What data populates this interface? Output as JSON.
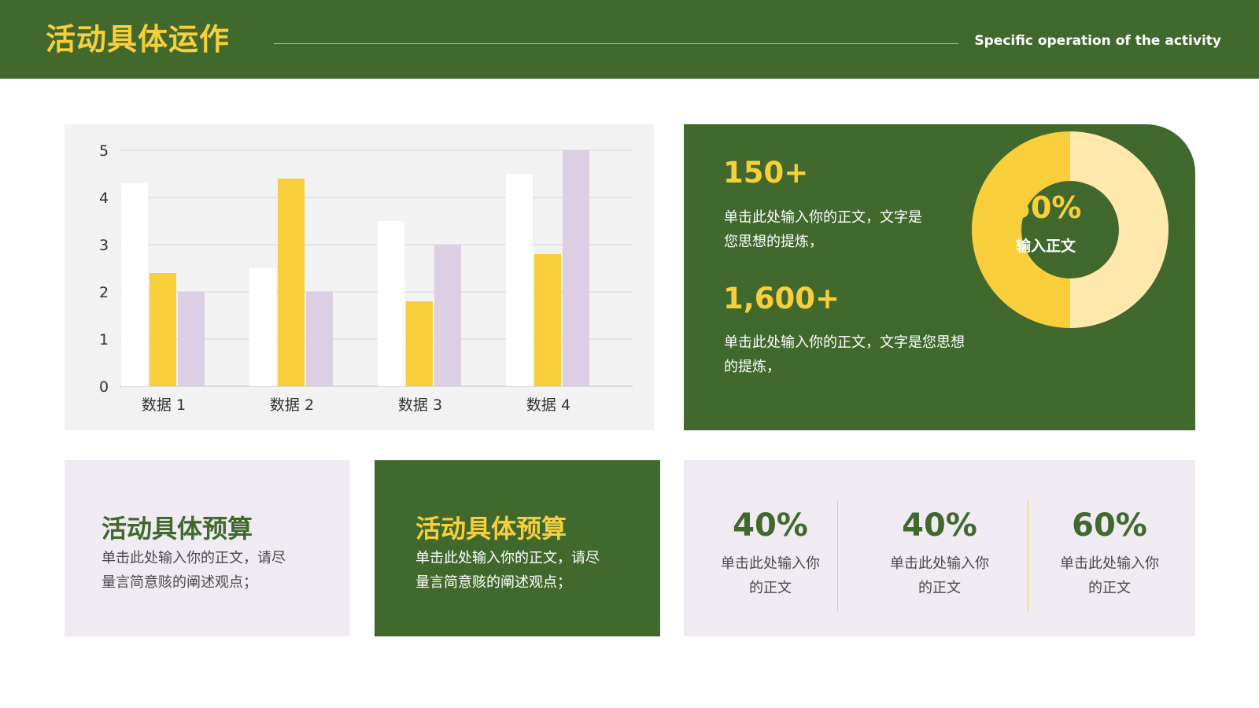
{
  "header": {
    "title": "活动具体运作",
    "subtitle": "Specific operation of the activity"
  },
  "chart_data": {
    "type": "bar",
    "categories": [
      "数据 1",
      "数据 2",
      "数据 3",
      "数据 4"
    ],
    "series": [
      {
        "values": [
          4.3,
          2.5,
          3.5,
          4.5
        ],
        "color": "#ffffff"
      },
      {
        "values": [
          2.4,
          4.4,
          1.8,
          2.8
        ],
        "color": "#f8cf3a"
      },
      {
        "values": [
          2.0,
          2.0,
          3.0,
          5.0
        ],
        "color": "#dccfe3"
      }
    ],
    "yticks": [
      "0",
      "1",
      "2",
      "3",
      "4",
      "5"
    ],
    "ylim": [
      0,
      5
    ],
    "grid": true,
    "legend": "none"
  },
  "stats": {
    "items": [
      {
        "value": "150+",
        "text_lines": [
          "单击此处输入你的正文，文字是",
          "您思想的提炼，"
        ]
      },
      {
        "value": "1,600+",
        "text_lines": [
          "单击此处输入你的正文，文字是您思想",
          "的提炼，"
        ]
      }
    ],
    "donut": {
      "percent_value": 0.5,
      "percent_label": "50%",
      "label": "输入正文",
      "fill_color": "#f8cf3a",
      "rest_color": "#fde9ac"
    }
  },
  "cards": [
    {
      "title": "活动具体预算",
      "text_lines": [
        "单击此处输入你的正文，请尽",
        "量言简意赅的阐述观点；"
      ]
    },
    {
      "title": "活动具体预算",
      "text_lines": [
        "单击此处输入你的正文，请尽",
        "量言简意赅的阐述观点；"
      ]
    }
  ],
  "percentages": [
    {
      "value": "40%",
      "text_lines": [
        "单击此处输入你",
        "的正文"
      ]
    },
    {
      "value": "40%",
      "text_lines": [
        "单击此处输入你",
        "的正文"
      ]
    },
    {
      "value": "60%",
      "text_lines": [
        "单击此处输入你",
        "的正文"
      ]
    }
  ],
  "colors": {
    "primary_green": "#41692d",
    "accent_yellow": "#f8cf3a",
    "light_yellow": "#fde9ac",
    "light_lavender": "#f0ebf3",
    "chart_panel": "#f2f2f2",
    "bar_lavender": "#dccfe3"
  }
}
